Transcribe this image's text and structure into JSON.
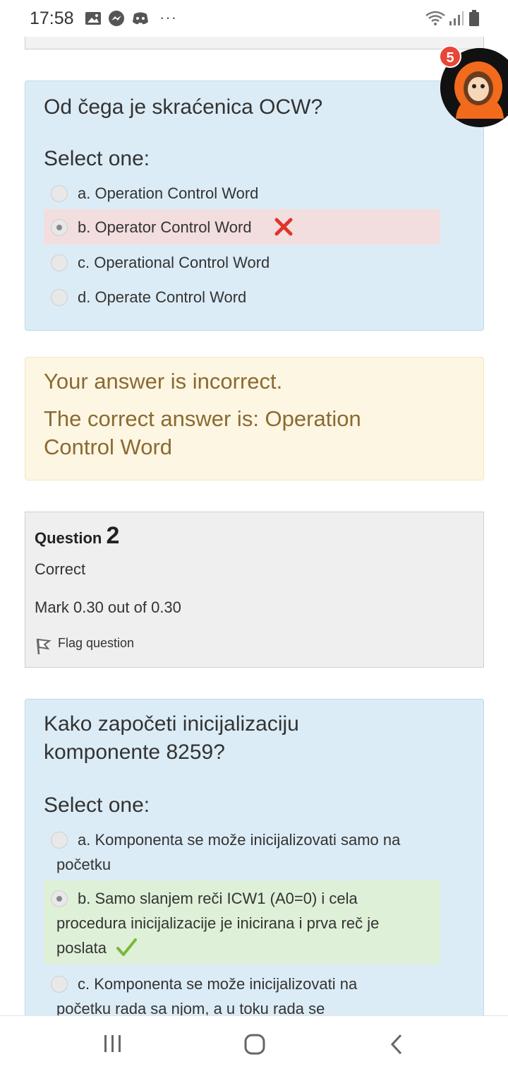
{
  "status_bar": {
    "time": "17:58",
    "icons_left": [
      "gallery-icon",
      "messenger-icon",
      "discord-icon",
      "more-icon"
    ],
    "icons_right": [
      "wifi-icon",
      "signal-icon",
      "battery-icon"
    ],
    "more": "···"
  },
  "chat_head": {
    "badge": "5"
  },
  "q1": {
    "text": "Od čega je skraćenica OCW?",
    "prompt": "Select one:",
    "options": [
      {
        "label": "a. Operation Control Word",
        "checked": false,
        "state": ""
      },
      {
        "label": "b. Operator Control Word",
        "checked": true,
        "state": "incorrect"
      },
      {
        "label": "c. Operational Control Word",
        "checked": false,
        "state": ""
      },
      {
        "label": "d. Operate Control Word",
        "checked": false,
        "state": ""
      }
    ]
  },
  "feedback": {
    "line1": "Your answer is incorrect.",
    "line2a": "The correct answer is: Operation",
    "line2b": "Control Word"
  },
  "q2_info": {
    "label": "Question",
    "number": "2",
    "state": "Correct",
    "grade": "Mark 0.30 out of 0.30",
    "flag": "Flag question"
  },
  "q2": {
    "text_line1": "Kako započeti inicijalizaciju",
    "text_line2": "komponente 8259?",
    "prompt": "Select one:",
    "options": [
      {
        "line1": "a. Komponenta se može inicijalizovati samo na",
        "line2": "početku",
        "line3": "",
        "checked": false,
        "state": ""
      },
      {
        "line1": "b. Samo slanjem reči ICW1 (A0=0) i cela",
        "line2": "procedura inicijalizacije je inicirana i prva reč je",
        "line3": "poslata",
        "checked": true,
        "state": "correct"
      },
      {
        "line1": "c. Komponenta se može inicijalizovati na",
        "line2": "početku rada sa njom, a u toku rada se",
        "line3": "",
        "checked": false,
        "state": ""
      }
    ]
  },
  "colors": {
    "question_bg": "#dcecf6",
    "incorrect_bg": "#f2dedf",
    "correct_bg": "#dff0d8",
    "feedback_bg": "#fcf6e2",
    "feedback_text": "#8b6a32",
    "badge": "#e74638"
  }
}
